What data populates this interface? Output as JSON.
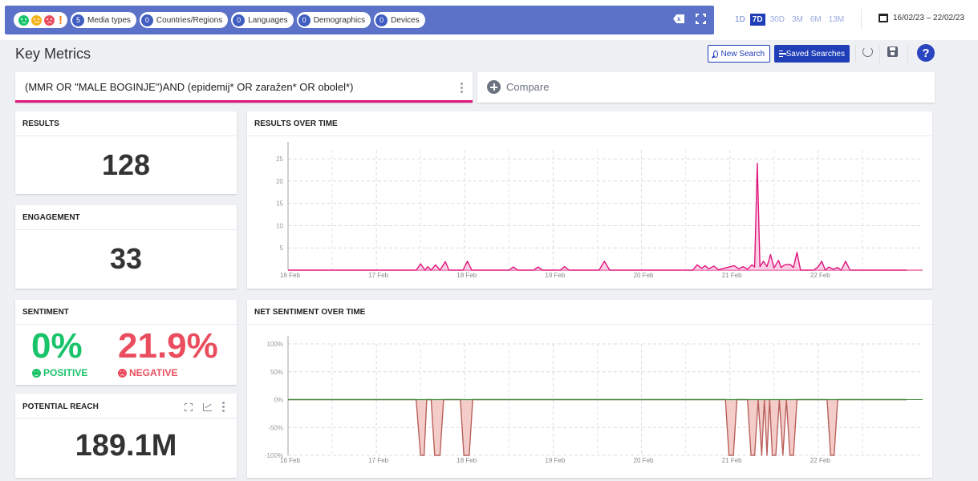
{
  "filters": {
    "chips": [
      {
        "count": "5",
        "label": "Media types"
      },
      {
        "count": "0",
        "label": "Countries/Regions"
      },
      {
        "count": "0",
        "label": "Languages"
      },
      {
        "count": "0",
        "label": "Demographics"
      },
      {
        "count": "0",
        "label": "Devices"
      }
    ],
    "sentiment_icons": [
      "positive-icon",
      "neutral-icon",
      "negative-icon",
      "alert-icon"
    ],
    "alert_glyph": "!"
  },
  "periods": [
    {
      "label": "1D",
      "state": "normal"
    },
    {
      "label": "7D",
      "state": "active"
    },
    {
      "label": "30D",
      "state": "dim"
    },
    {
      "label": "3M",
      "state": "dim"
    },
    {
      "label": "6M",
      "state": "dim"
    },
    {
      "label": "13M",
      "state": "dim"
    }
  ],
  "date_range": "16/02/23 – 22/02/23",
  "page_title": "Key Metrics",
  "buttons": {
    "new_search": "New Search",
    "saved_searches": "Saved Searches",
    "help": "?"
  },
  "query": {
    "text": "(MMR OR \"MALE BOGINJE\")AND (epidemij* OR zaražen* OR obolel*)",
    "compare": "Compare"
  },
  "cards": {
    "results": {
      "title": "RESULTS",
      "value": "128"
    },
    "engagement": {
      "title": "ENGAGEMENT",
      "value": "33"
    },
    "sentiment": {
      "title": "SENTIMENT",
      "positive": "0%",
      "positive_label": "POSITIVE",
      "negative": "21.9%",
      "negative_label": "NEGATIVE"
    },
    "reach": {
      "title": "POTENTIAL REACH",
      "value": "189.1M"
    },
    "results_over_time": {
      "title": "RESULTS OVER TIME"
    },
    "net_sentiment": {
      "title": "NET SENTIMENT OVER TIME"
    }
  },
  "colors": {
    "accent": "#1f3eb8",
    "filterbar": "#5b72c8",
    "positive": "#19c36a",
    "negative": "#ea4e5e",
    "neutral": "#f5b21a",
    "series_pink": "#e0157d",
    "sentiment_line": "#3a8a3a",
    "sentiment_fill": "#f3c8c5"
  },
  "chart_data": [
    {
      "type": "area",
      "title": "RESULTS OVER TIME",
      "x_ticks": [
        "16 Feb",
        "17 Feb",
        "18 Feb",
        "19 Feb",
        "20 Feb",
        "21 Feb",
        "22 Feb"
      ],
      "y_ticks": [
        "5",
        "10",
        "15",
        "20",
        "25"
      ],
      "ylim": [
        0,
        27
      ],
      "xlim": [
        0,
        7
      ],
      "x_unit": "days since 16 Feb",
      "series": [
        {
          "color": "#e0157d",
          "points": [
            [
              0,
              0
            ],
            [
              1.45,
              0
            ],
            [
              1.5,
              1.4
            ],
            [
              1.55,
              0
            ],
            [
              1.58,
              0.8
            ],
            [
              1.62,
              0
            ],
            [
              1.67,
              1.2
            ],
            [
              1.72,
              0
            ],
            [
              1.78,
              1.9
            ],
            [
              1.82,
              0
            ],
            [
              1.98,
              0
            ],
            [
              2.03,
              2
            ],
            [
              2.08,
              0
            ],
            [
              2.5,
              0
            ],
            [
              2.55,
              0.7
            ],
            [
              2.6,
              0
            ],
            [
              2.78,
              0
            ],
            [
              2.83,
              0.7
            ],
            [
              2.88,
              0
            ],
            [
              3.08,
              0
            ],
            [
              3.13,
              0.8
            ],
            [
              3.18,
              0
            ],
            [
              3.52,
              0
            ],
            [
              3.58,
              2
            ],
            [
              3.64,
              0
            ],
            [
              4.58,
              0
            ],
            [
              4.63,
              1.2
            ],
            [
              4.68,
              0.4
            ],
            [
              4.72,
              1
            ],
            [
              4.76,
              0.3
            ],
            [
              4.82,
              0.9
            ],
            [
              4.87,
              0.1
            ],
            [
              4.95,
              0.5
            ],
            [
              5.05,
              1
            ],
            [
              5.1,
              0.3
            ],
            [
              5.15,
              0.8
            ],
            [
              5.2,
              0.2
            ],
            [
              5.25,
              1.2
            ],
            [
              5.28,
              0.7
            ],
            [
              5.31,
              24
            ],
            [
              5.34,
              0.8
            ],
            [
              5.38,
              2
            ],
            [
              5.42,
              0.8
            ],
            [
              5.46,
              3.5
            ],
            [
              5.5,
              0.5
            ],
            [
              5.55,
              2.2
            ],
            [
              5.58,
              0.6
            ],
            [
              5.62,
              1.2
            ],
            [
              5.68,
              1.3
            ],
            [
              5.72,
              0.6
            ],
            [
              5.76,
              4
            ],
            [
              5.8,
              0
            ],
            [
              5.95,
              0
            ],
            [
              6.0,
              0.8
            ],
            [
              6.04,
              2
            ],
            [
              6.08,
              0
            ],
            [
              6.12,
              0.7
            ],
            [
              6.17,
              0.2
            ],
            [
              6.22,
              0.6
            ],
            [
              6.26,
              0
            ],
            [
              6.31,
              2
            ],
            [
              6.36,
              0
            ],
            [
              7,
              0
            ]
          ]
        }
      ]
    },
    {
      "type": "area",
      "title": "NET SENTIMENT OVER TIME",
      "x_ticks": [
        "16 Feb",
        "17 Feb",
        "18 Feb",
        "19 Feb",
        "20 Feb",
        "21 Feb",
        "22 Feb"
      ],
      "y_ticks": [
        "100%",
        "50%",
        "0%",
        "-50%",
        "-100%"
      ],
      "ylim": [
        -100,
        100
      ],
      "xlim": [
        0,
        7
      ],
      "x_unit": "days since 16 Feb",
      "series": [
        {
          "color": "#3a8a3a",
          "points": [
            [
              0,
              0
            ],
            [
              1.45,
              0
            ],
            [
              1.5,
              -100
            ],
            [
              1.54,
              -100
            ],
            [
              1.57,
              0
            ],
            [
              1.62,
              0
            ],
            [
              1.66,
              -100
            ],
            [
              1.72,
              -100
            ],
            [
              1.76,
              0
            ],
            [
              1.95,
              0
            ],
            [
              1.99,
              -100
            ],
            [
              2.05,
              -100
            ],
            [
              2.09,
              0
            ],
            [
              4.95,
              0
            ],
            [
              4.99,
              -100
            ],
            [
              5.04,
              -100
            ],
            [
              5.08,
              0
            ],
            [
              5.2,
              0
            ],
            [
              5.24,
              -100
            ],
            [
              5.28,
              -100
            ],
            [
              5.32,
              0
            ],
            [
              5.36,
              -100
            ],
            [
              5.39,
              0
            ],
            [
              5.42,
              -100
            ],
            [
              5.45,
              0
            ],
            [
              5.48,
              -100
            ],
            [
              5.52,
              -100
            ],
            [
              5.56,
              0
            ],
            [
              5.6,
              -100
            ],
            [
              5.64,
              0
            ],
            [
              5.68,
              -100
            ],
            [
              5.72,
              -100
            ],
            [
              5.76,
              0
            ],
            [
              6.1,
              0
            ],
            [
              6.14,
              -100
            ],
            [
              6.18,
              -100
            ],
            [
              6.22,
              0
            ],
            [
              7,
              0
            ]
          ]
        }
      ]
    }
  ]
}
